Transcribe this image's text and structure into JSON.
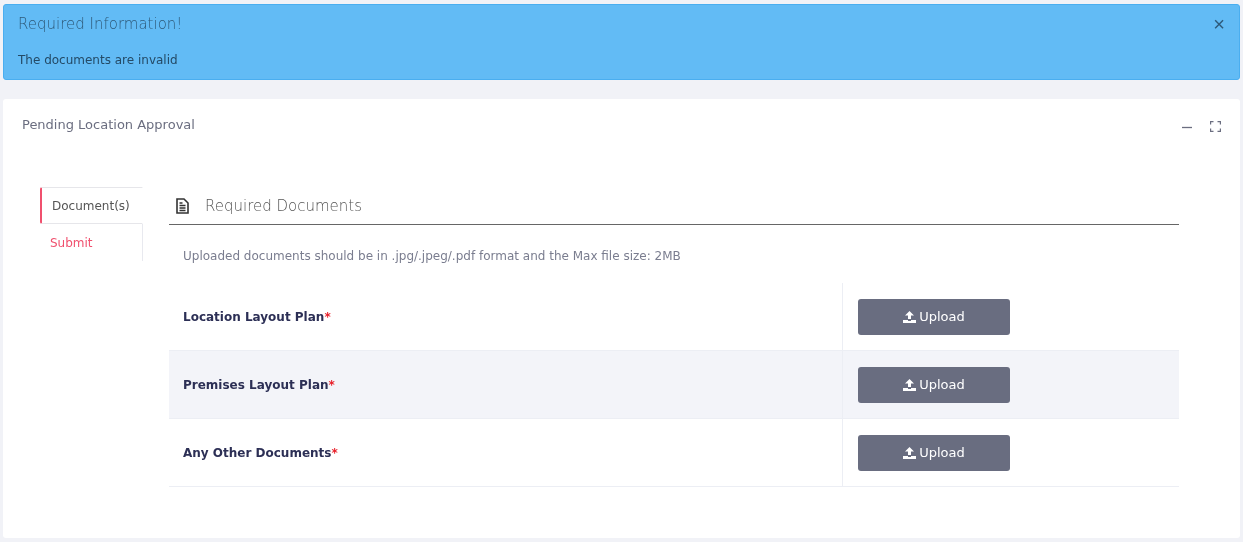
{
  "alert": {
    "title": "Required Information!",
    "message": "The documents are invalid",
    "close": "×"
  },
  "panel": {
    "title": "Pending Location Approval"
  },
  "tabs": [
    {
      "label": "Document(s)",
      "selected": true
    },
    {
      "label": "Submit",
      "selected": false
    }
  ],
  "section": {
    "title": "Required Documents",
    "note": "Uploaded documents should be in .jpg/.jpeg/.pdf format and the Max file size: 2MB"
  },
  "documents": [
    {
      "name": "Location Layout Plan",
      "required_mark": "*",
      "button": "Upload"
    },
    {
      "name": "Premises Layout Plan",
      "required_mark": "*",
      "button": "Upload"
    },
    {
      "name": "Any Other Documents",
      "required_mark": "*",
      "button": "Upload"
    }
  ]
}
